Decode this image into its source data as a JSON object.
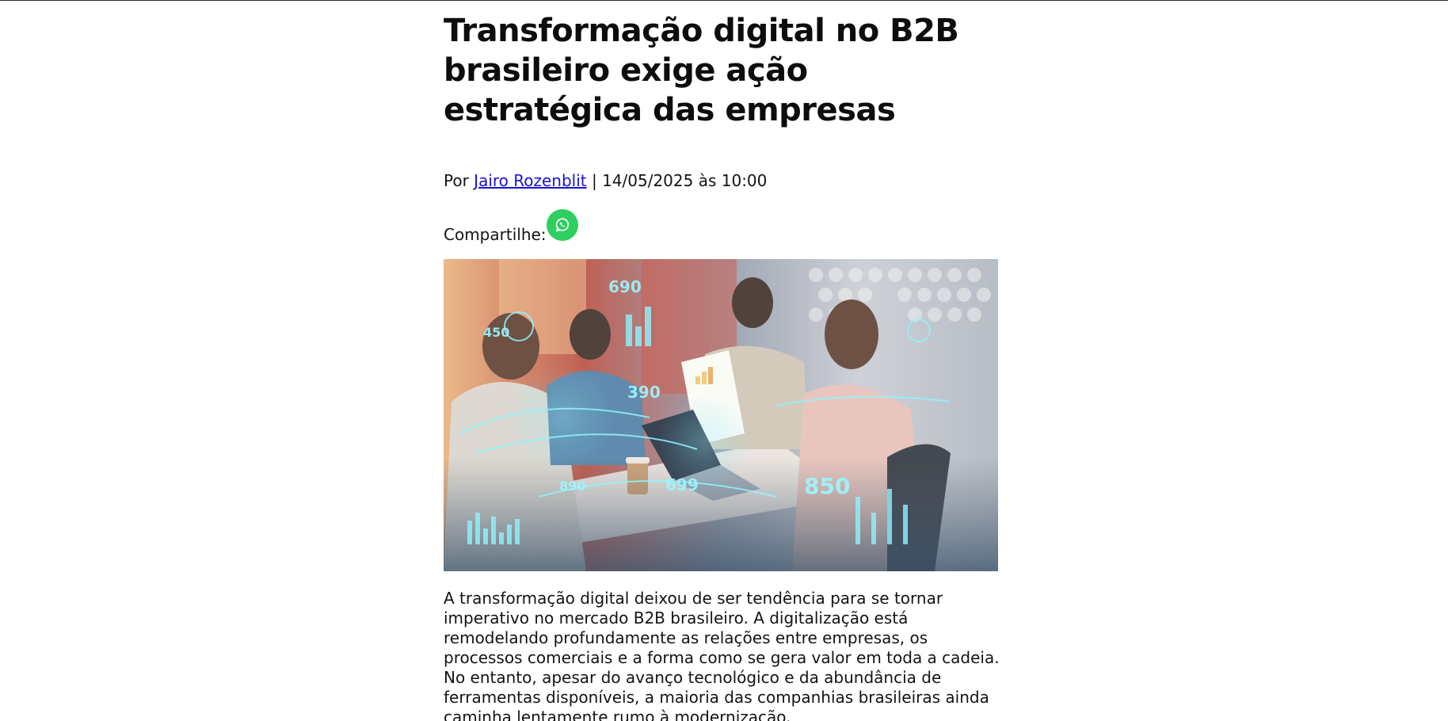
{
  "article": {
    "title": "Transformação digital no B2B brasileiro exige ação estratégica das empresas",
    "byline": {
      "prefix": "Por ",
      "author": "Jairo Rozenblit",
      "separator": " | ",
      "datetime": "14/05/2025 às 10:00"
    },
    "share": {
      "label": "Compartilhe:",
      "whatsapp_icon": "whatsapp-icon",
      "whatsapp_color": "#2fcf5f"
    },
    "hero_image": {
      "overlay_numbers": [
        "690",
        "450",
        "390",
        "890",
        "699",
        "850"
      ]
    },
    "paragraph": "A transformação digital deixou de ser tendência para se tornar imperativo no mercado B2B brasileiro. A digitalização está remodelando profundamente as relações entre empresas, os processos comerciais e a forma como se gera valor em toda a cadeia. No entanto, apesar do avanço tecnológico e da abundância de ferramentas disponíveis, a maioria das companhias brasileiras ainda caminha lentamente rumo à modernização."
  },
  "colors": {
    "link": "#1a12d6",
    "text": "#111111",
    "background": "#ffffff"
  }
}
